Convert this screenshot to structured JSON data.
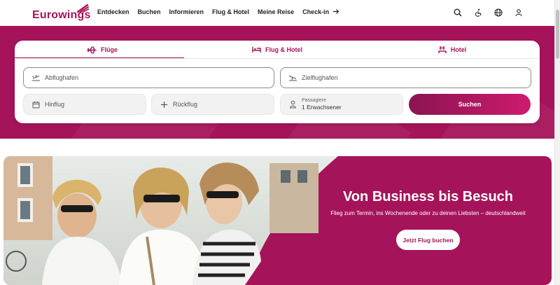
{
  "header": {
    "logo": "Eurowings",
    "nav": [
      "Entdecken",
      "Buchen",
      "Informieren",
      "Flug & Hotel",
      "Meine Reise",
      "Check-in"
    ],
    "icons": [
      "search-icon",
      "accessibility-icon",
      "globe-icon",
      "user-icon"
    ]
  },
  "booking": {
    "tabs": [
      {
        "label": "Flüge",
        "icon": "plane-icon"
      },
      {
        "label": "Flug & Hotel",
        "icon": "bed-icon"
      },
      {
        "label": "Hotel",
        "icon": "hotel-icon"
      }
    ],
    "origin_placeholder": "Abflughafen",
    "destination_placeholder": "Zielflughafen",
    "outbound_placeholder": "Hinflug",
    "return_placeholder": "Rückflug",
    "passengers_label": "Passagiere",
    "passengers_value": "1 Erwachsener",
    "search_label": "Suchen"
  },
  "promo": {
    "title": "Von Business bis Besuch",
    "subtitle": "Flieg zum Termin, ins Wochenende oder zu deinen Liebsten – deutschlandweit",
    "button": "Jetzt Flug buchen"
  },
  "colors": {
    "brand": "#a5145a",
    "brand_light": "#cf1a6f"
  }
}
